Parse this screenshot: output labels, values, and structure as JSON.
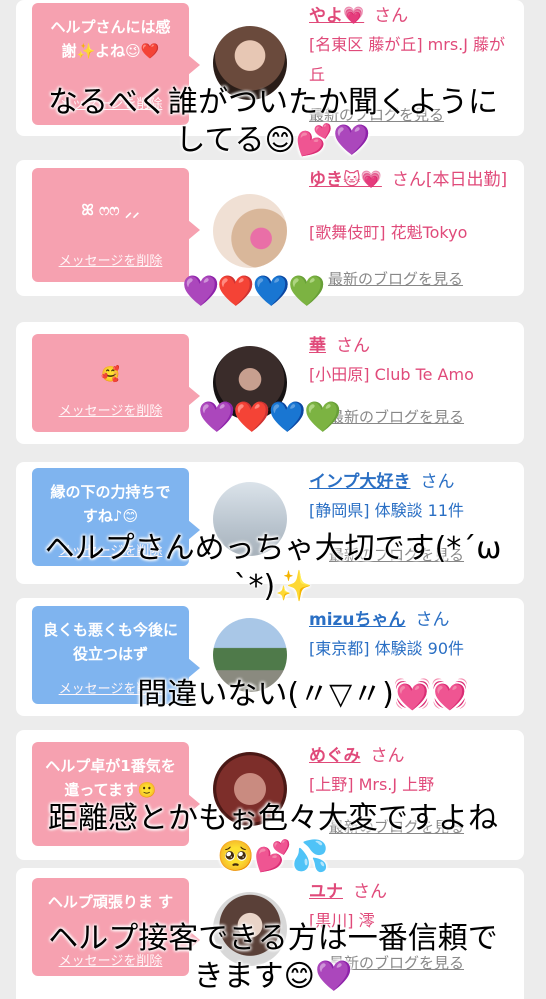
{
  "common": {
    "delete_label": "メッセージを削除",
    "blog_label": "最新のブログを見る",
    "honorific": "さん"
  },
  "cards": [
    {
      "message": "ヘルプさんには感謝✨よね😉❤️",
      "name": "やよ💗",
      "shop": "[名東区 藤が丘] mrs.J 藤が丘",
      "type": "pink"
    },
    {
      "message": "ꕤ ෆෆ ⸝⸝",
      "name": "ゆき🐱💗",
      "shop_prefix": "[本日出勤]",
      "shop": "[歌舞伎町] 花魁Tokyo",
      "type": "pink"
    },
    {
      "message": "🥰",
      "name": "華",
      "shop": "[小田原] Club Te Amo",
      "type": "pink"
    },
    {
      "message": "縁の下の力持ちですね♪😊",
      "name": "インプ大好き",
      "shop": "[静岡県] 体験談 11件",
      "type": "blue"
    },
    {
      "message": "良くも悪くも今後に役立つはず",
      "name": "mizuちゃん",
      "shop": "[東京都] 体験談 90件",
      "type": "blue"
    },
    {
      "message": "ヘルプ卓が1番気を遣ってます🙂",
      "name": "めぐみ",
      "shop": "[上野] Mrs.J 上野",
      "type": "pink"
    },
    {
      "message": "ヘルプ頑張りま す",
      "name": "ユナ",
      "shop": "[黒川] 澪",
      "type": "pink"
    }
  ],
  "overlays": [
    "なるべく誰がついたか聞くように\nしてる😊💕💜",
    "💜❤️💙💚",
    "💜❤️💙💚",
    "ヘルプさんめっちゃ大切です(*´ω\n`*)✨",
    "間違いない(〃▽〃)💓💓",
    "距離感とかもぉ色々大変ですよね\n🥺💕💦",
    "ヘルプ接客できる方は一番信頼で\nきます😊💜"
  ]
}
